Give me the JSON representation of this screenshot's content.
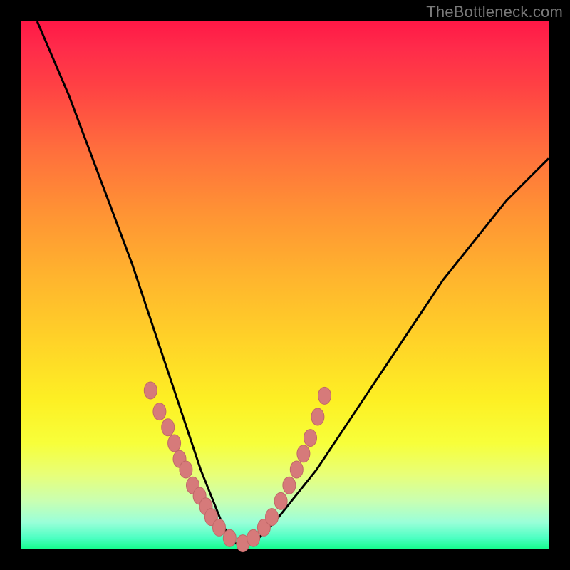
{
  "watermark": "TheBottleneck.com",
  "colors": {
    "frame": "#000000",
    "gradient_top": "#ff1846",
    "gradient_bottom": "#17fd8f",
    "curve": "#000000",
    "marker_fill": "#d67a7a",
    "marker_stroke": "#c06868"
  },
  "chart_data": {
    "type": "line",
    "title": "",
    "xlabel": "",
    "ylabel": "",
    "xlim": [
      0,
      100
    ],
    "ylim": [
      0,
      100
    ],
    "grid": false,
    "legend": false,
    "notes": "V-shaped bottleneck curve on rainbow gradient. Values are estimated from pixel positions (no axis ticks in original). y≈0 at minimum, y≈100 at image top.",
    "series": [
      {
        "name": "curve",
        "x": [
          3,
          6,
          9,
          12,
          15,
          18,
          21,
          24,
          27,
          30,
          32,
          34,
          36,
          38,
          40,
          44,
          48,
          52,
          56,
          60,
          64,
          68,
          72,
          76,
          80,
          84,
          88,
          92,
          96,
          100
        ],
        "y": [
          100,
          93,
          86,
          78,
          70,
          62,
          54,
          45,
          36,
          27,
          21,
          15,
          10,
          5,
          1,
          1,
          5,
          10,
          15,
          21,
          27,
          33,
          39,
          45,
          51,
          56,
          61,
          66,
          70,
          74
        ]
      }
    ],
    "markers": {
      "name": "sample-dots",
      "x": [
        24.5,
        26.2,
        27.8,
        29.0,
        30.0,
        31.2,
        32.5,
        33.8,
        35.0,
        36.0,
        37.5,
        39.5,
        42.0,
        44.0,
        46.0,
        47.5,
        49.2,
        50.8,
        52.2,
        53.5,
        54.8,
        56.2,
        57.5
      ],
      "y": [
        30,
        26,
        23,
        20,
        17,
        15,
        12,
        10,
        8,
        6,
        4,
        2,
        1,
        2,
        4,
        6,
        9,
        12,
        15,
        18,
        21,
        25,
        29
      ]
    }
  }
}
